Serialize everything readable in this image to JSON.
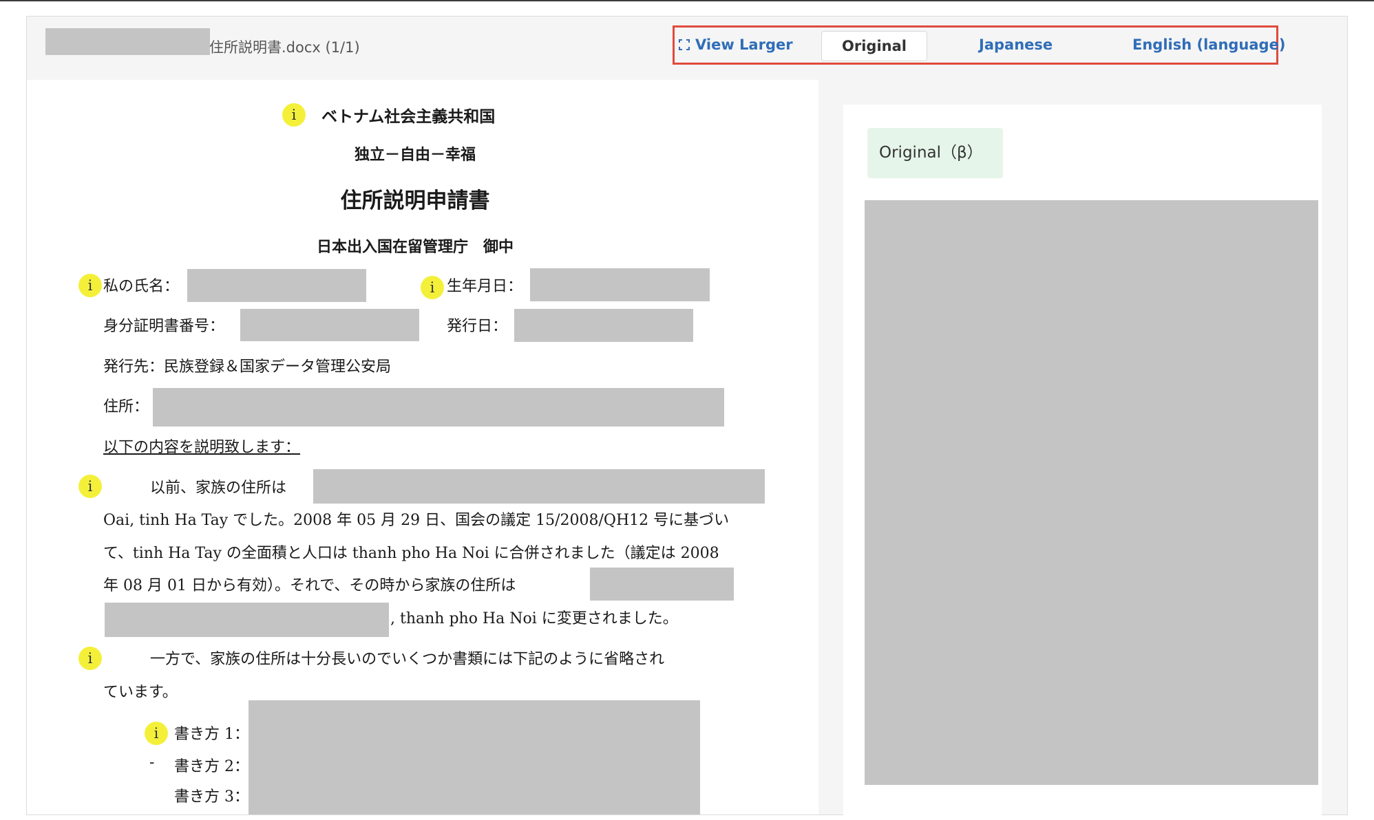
{
  "toolbar": {
    "filename": "住所説明書.docx (1/1)",
    "view_larger": "View Larger",
    "original": "Original",
    "japanese": "Japanese",
    "english": "English (language)"
  },
  "document": {
    "country": "ベトナム社会主義共和国",
    "motto": "独立－自由－幸福",
    "title": "住所説明申請書",
    "addressee": "日本出入国在留管理庁　御中",
    "name_label": "私の氏名：",
    "birthdate_label": "生年月日：",
    "id_number_label": "身分証明書番号：",
    "issue_date_label": "発行日：",
    "issuer": "発行先：民族登録＆国家データ管理公安局",
    "address_label": "住所：",
    "statement_intro": "以下の内容を説明致します：",
    "para1_line1": "以前、家族の住所は",
    "para1_line2": "Oai, tinh Ha Tay でした。2008 年 05 月 29 日、国会の議定 15/2008/QH12 号に基づい",
    "para1_line3": "て、tinh Ha Tay の全面積と人口は thanh pho Ha Noi に合併されました（議定は 2008",
    "para1_line4": "年 08 月 01 日から有効）。それで、その時から家族の住所は",
    "para1_line5": ", thanh pho Ha Noi に変更されました。",
    "para2_line1": "一方で、家族の住所は十分長いのでいくつか書類には下記のように省略され",
    "para2_line2": "ています。",
    "writing1": "書き方 1：",
    "writing2_dash": "-",
    "writing2": "書き方 2：",
    "writing3": "書き方 3："
  },
  "preview": {
    "badge": "Original（β）"
  },
  "icons": {
    "info": "i",
    "expand": "expand-icon"
  },
  "colors": {
    "accent": "#2f6db8",
    "highlight_border": "#e04a3c",
    "info_badge": "#f4f03a",
    "redaction": "#c4c4c4"
  }
}
